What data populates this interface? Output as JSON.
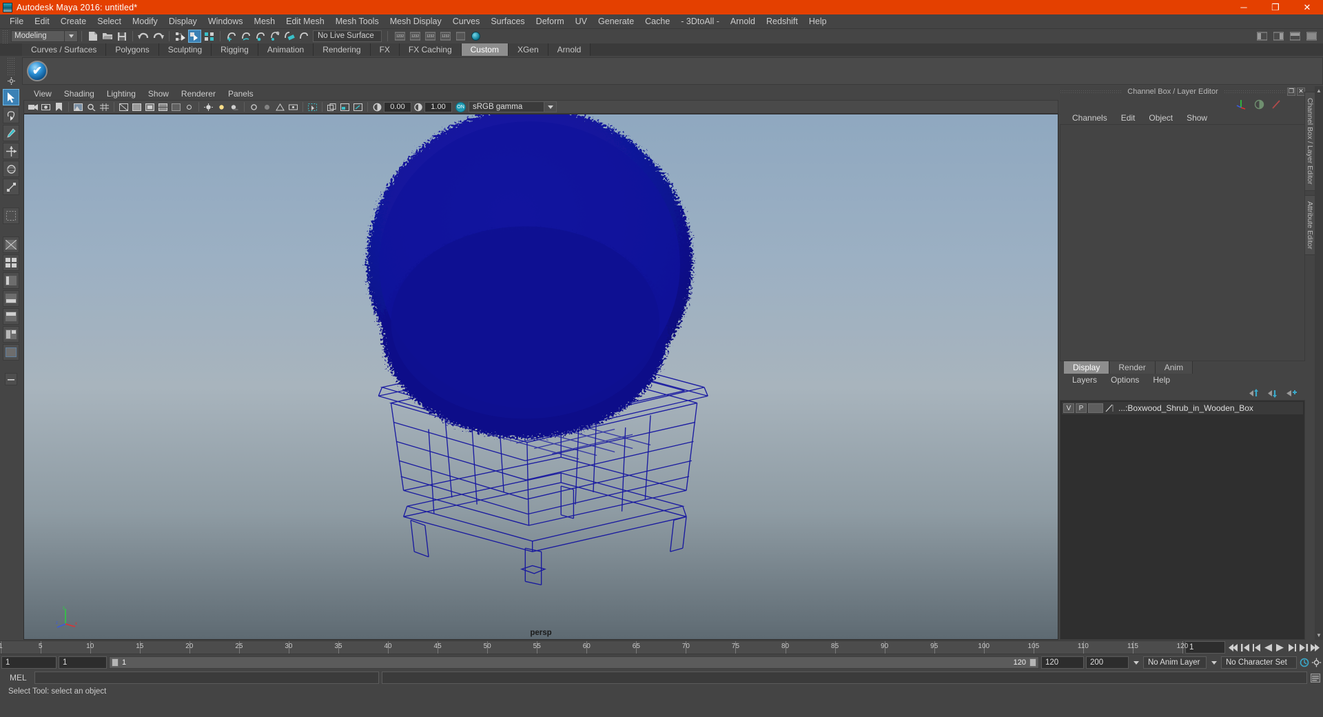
{
  "titlebar": {
    "title": "Autodesk Maya 2016: untitled*",
    "minimize": "─",
    "maximize": "❐",
    "close": "✕",
    "accent_color": "#e44000"
  },
  "menubar": {
    "items": [
      "File",
      "Edit",
      "Create",
      "Select",
      "Modify",
      "Display",
      "Windows",
      "Mesh",
      "Edit Mesh",
      "Mesh Tools",
      "Mesh Display",
      "Curves",
      "Surfaces",
      "Deform",
      "UV",
      "Generate",
      "Cache",
      "- 3DtoAll -",
      "Arnold",
      "Redshift",
      "Help"
    ]
  },
  "toolbar": {
    "menuset": "Modeling",
    "menuset_arrow": "▼",
    "live_surface": "No Live Surface",
    "icons": [
      "new-scene-icon",
      "open-scene-icon",
      "save-scene-icon",
      "undo-icon",
      "redo-icon",
      "select-by-hierarchy-icon",
      "select-by-object-icon",
      "select-by-component-icon",
      "snap-to-grid-icon",
      "snap-to-curve-icon",
      "snap-to-point-icon",
      "snap-to-projected-center-icon",
      "snap-to-view-plane-icon",
      "make-live-icon"
    ]
  },
  "shelf": {
    "tabs": [
      "Curves / Surfaces",
      "Polygons",
      "Sculpting",
      "Rigging",
      "Animation",
      "Rendering",
      "FX",
      "FX Caching",
      "Custom",
      "XGen",
      "Arnold"
    ],
    "active_tab": "Custom",
    "button_icon": "checkmark-shelf-button",
    "button_glyph": "✔"
  },
  "toolbox": {
    "items": [
      "select-tool",
      "lasso-select-tool",
      "paint-select-tool",
      "move-tool",
      "rotate-tool",
      "scale-tool",
      "last-tool",
      "layout-single-perspective",
      "layout-four-view",
      "layout-persp-outliner",
      "layout-persp-graph",
      "layout-hypershade",
      "layout-persp-uv",
      "layout-relationship-editor",
      "layout-more"
    ]
  },
  "viewport": {
    "menus": [
      "View",
      "Shading",
      "Lighting",
      "Show",
      "Renderer",
      "Panels"
    ],
    "camera_label": "persp",
    "toolbar": {
      "exposure_value": "0.00",
      "gamma_value": "1.00",
      "color_management_toggle": "ON",
      "view_transform": "sRGB gamma",
      "dropdown_arrow": "▼"
    },
    "axis": {
      "x": "x",
      "y": "y",
      "z": "z"
    },
    "object": {
      "name": "Boxwood_Shrub_in_Wooden_Box",
      "wireframe_color": "#1414a0",
      "shrub_color": "#0c1385"
    }
  },
  "right_panel": {
    "header_title": "Channel Box / Layer Editor",
    "undock_icon": "❐",
    "close_icon": "✕",
    "channel_menus": [
      "Channels",
      "Edit",
      "Object",
      "Show"
    ],
    "layer_tabs": [
      "Display",
      "Render",
      "Anim"
    ],
    "active_layer_tab": "Display",
    "layer_menus": [
      "Layers",
      "Options",
      "Help"
    ],
    "layers": [
      {
        "visibility": "V",
        "playback": "P",
        "color_swatch": "",
        "name": "...:Boxwood_Shrub_in_Wooden_Box"
      }
    ],
    "side_tabs": [
      "Channel Box / Layer Editor",
      "Attribute Editor"
    ]
  },
  "timeline": {
    "ticks": [
      {
        "label": "1",
        "value": 1
      },
      {
        "label": "5",
        "value": 5
      },
      {
        "label": "10",
        "value": 10
      },
      {
        "label": "15",
        "value": 15
      },
      {
        "label": "20",
        "value": 20
      },
      {
        "label": "25",
        "value": 25
      },
      {
        "label": "30",
        "value": 30
      },
      {
        "label": "35",
        "value": 35
      },
      {
        "label": "40",
        "value": 40
      },
      {
        "label": "45",
        "value": 45
      },
      {
        "label": "50",
        "value": 50
      },
      {
        "label": "55",
        "value": 55
      },
      {
        "label": "60",
        "value": 60
      },
      {
        "label": "65",
        "value": 65
      },
      {
        "label": "70",
        "value": 70
      },
      {
        "label": "75",
        "value": 75
      },
      {
        "label": "80",
        "value": 80
      },
      {
        "label": "85",
        "value": 85
      },
      {
        "label": "90",
        "value": 90
      },
      {
        "label": "95",
        "value": 95
      },
      {
        "label": "100",
        "value": 100
      },
      {
        "label": "105",
        "value": 105
      },
      {
        "label": "110",
        "value": 110
      },
      {
        "label": "115",
        "value": 115
      },
      {
        "label": "120",
        "value": 120
      }
    ],
    "start": 1,
    "end": 120,
    "current_frame": "1",
    "transport": [
      "go-to-start",
      "step-back-key",
      "step-back-frame",
      "play-backwards",
      "play-forwards",
      "step-forward-frame",
      "step-forward-key",
      "go-to-end"
    ]
  },
  "range": {
    "anim_start": "1",
    "range_start": "1",
    "range_bar_label": "1",
    "range_bar_end_label": "120",
    "range_end": "120",
    "anim_end": "200",
    "anim_layer": "No Anim Layer",
    "anim_layer_arrow": "▼",
    "character_set": "No Character Set",
    "auto_key_icon": "auto-keyframe-icon",
    "anim_prefs_icon": "animation-preferences-icon"
  },
  "command_line": {
    "label": "MEL",
    "input_value": "",
    "help_icon": "script-editor-icon"
  },
  "status_bar": {
    "message": "Select Tool: select an object"
  }
}
